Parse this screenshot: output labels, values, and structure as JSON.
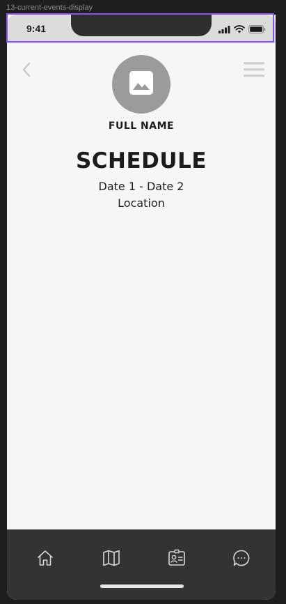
{
  "frame": {
    "label": "13-current-events-display"
  },
  "status_bar": {
    "time": "9:41",
    "icons": [
      "cellular-signal-icon",
      "wifi-icon",
      "battery-icon"
    ]
  },
  "header": {
    "back_icon": "chevron-left-icon",
    "menu_icon": "hamburger-menu-icon",
    "avatar_icon": "image-placeholder-icon",
    "full_name": "FULL NAME"
  },
  "schedule": {
    "title": "SCHEDULE",
    "dates": "Date 1 - Date 2",
    "location": "Location"
  },
  "bottom_nav": {
    "items": [
      {
        "icon": "home-icon"
      },
      {
        "icon": "map-icon"
      },
      {
        "icon": "id-card-icon"
      },
      {
        "icon": "chat-bubble-icon"
      }
    ]
  },
  "colors": {
    "screen_background": "#f6f6f6",
    "status_bar_background": "#dcdcdc",
    "nav_background": "#333333",
    "avatar_background": "#9b9b9b",
    "selection_outline": "#8a4ff0",
    "text_primary": "#1c1c1c"
  }
}
